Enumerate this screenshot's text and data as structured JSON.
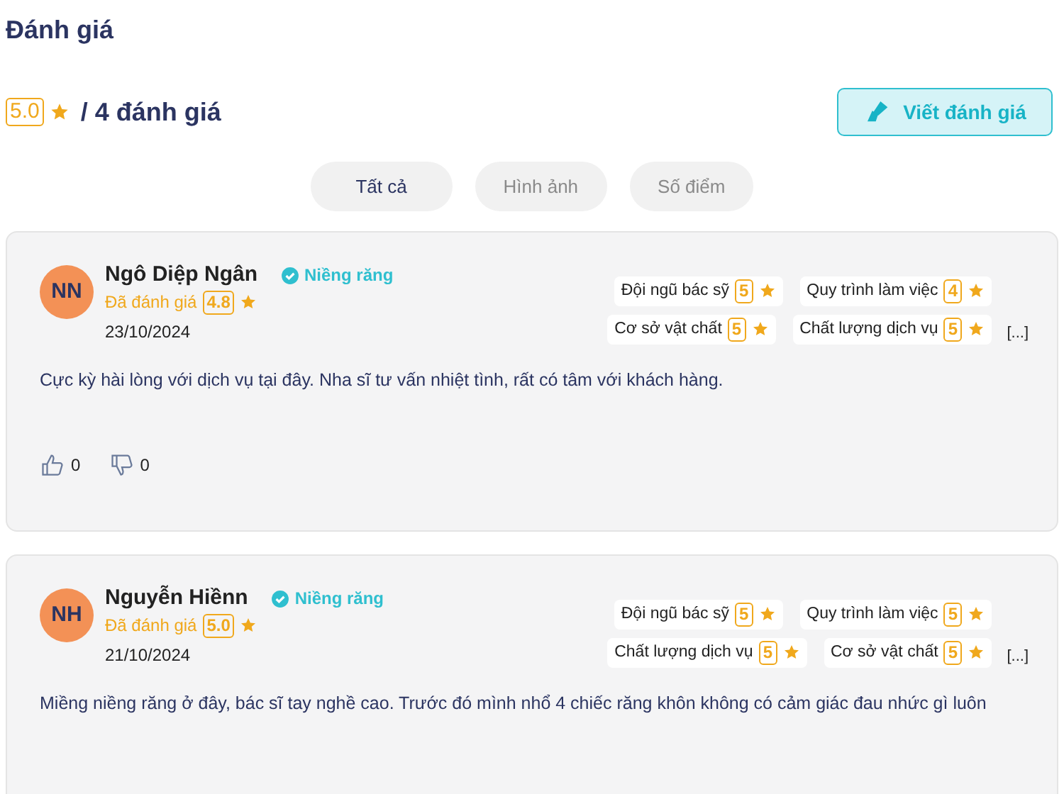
{
  "title": "Đánh giá",
  "summary": {
    "score": "5.0",
    "count": "/ 4 đánh giá"
  },
  "write_button": {
    "label": "Viết đánh giá"
  },
  "tabs": [
    {
      "label": "Tất cả",
      "selected": true
    },
    {
      "label": "Hình ảnh",
      "selected": false
    },
    {
      "label": "Số điểm",
      "selected": false
    }
  ],
  "reviews": [
    {
      "initials": "NN",
      "name": "Ngô Diệp Ngân",
      "tag": "Niềng răng",
      "rated_label": "Đã đánh giá",
      "score": "4.8",
      "date": "23/10/2024",
      "criteria": [
        {
          "label": "Đội ngũ bác sỹ",
          "score": "5"
        },
        {
          "label": "Quy trình làm việc",
          "score": "4"
        },
        {
          "label": "Cơ sở vật chất",
          "score": "5"
        },
        {
          "label": "Chất lượng dịch vụ",
          "score": "5"
        }
      ],
      "more": "[...]",
      "text": "Cực kỳ hài lòng với dịch vụ tại đây. Nha sĩ tư vấn nhiệt tình, rất có tâm với khách hàng.",
      "likes": "0",
      "dislikes": "0"
    },
    {
      "initials": "NH",
      "name": "Nguyễn Hiềnn",
      "tag": "Niềng răng",
      "rated_label": "Đã đánh giá",
      "score": "5.0",
      "date": "21/10/2024",
      "criteria": [
        {
          "label": "Đội ngũ bác sỹ",
          "score": "5"
        },
        {
          "label": "Quy trình làm việc",
          "score": "5"
        },
        {
          "label": "Chất lượng dịch vụ",
          "score": "5"
        },
        {
          "label": "Cơ sở vật chất",
          "score": "5"
        }
      ],
      "more": "[...]",
      "text": "Miềng niềng răng ở đây, bác sĩ tay nghề cao. Trước đó mình nhổ 4 chiếc răng khôn không có cảm giác đau nhức gì luôn"
    }
  ]
}
